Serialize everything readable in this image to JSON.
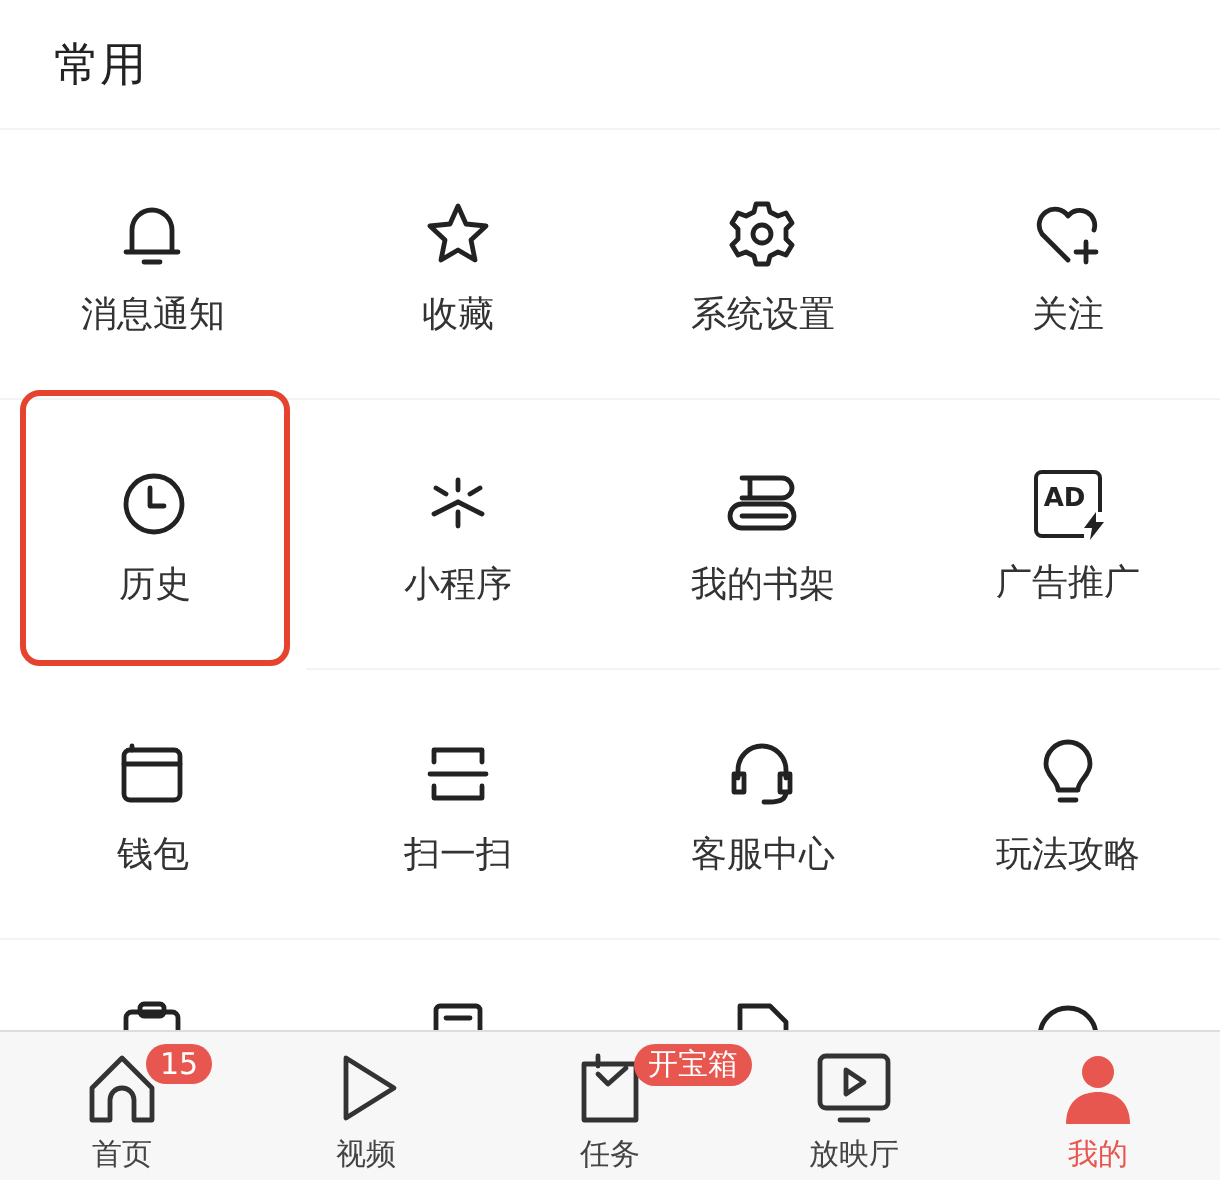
{
  "section_title": "常用",
  "items": [
    {
      "label": "消息通知",
      "highlighted": false
    },
    {
      "label": "收藏",
      "highlighted": false
    },
    {
      "label": "系统设置",
      "highlighted": false
    },
    {
      "label": "关注",
      "highlighted": false
    },
    {
      "label": "历史",
      "highlighted": true
    },
    {
      "label": "小程序",
      "highlighted": false
    },
    {
      "label": "我的书架",
      "highlighted": false
    },
    {
      "label": "广告推广",
      "highlighted": false,
      "icon_text": "AD"
    },
    {
      "label": "钱包",
      "highlighted": false
    },
    {
      "label": "扫一扫",
      "highlighted": false
    },
    {
      "label": "客服中心",
      "highlighted": false
    },
    {
      "label": "玩法攻略",
      "highlighted": false
    }
  ],
  "tab_bar": [
    {
      "label": "首页",
      "selected": false,
      "badge": "15"
    },
    {
      "label": "视频",
      "selected": false
    },
    {
      "label": "任务",
      "selected": false,
      "badge": "开宝箱"
    },
    {
      "label": "放映厅",
      "selected": false
    },
    {
      "label": "我的",
      "selected": true
    }
  ]
}
